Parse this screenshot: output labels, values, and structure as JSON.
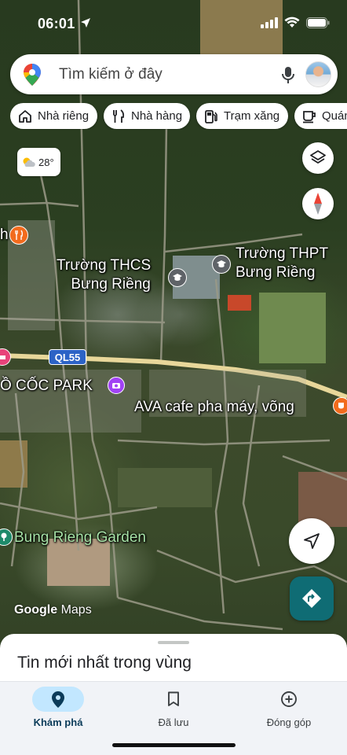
{
  "status_bar": {
    "time": "06:01"
  },
  "search": {
    "placeholder": "Tìm kiếm ở đây"
  },
  "chips": [
    {
      "label": "Nhà riêng",
      "icon": "home-icon"
    },
    {
      "label": "Nhà hàng",
      "icon": "restaurant-icon"
    },
    {
      "label": "Trạm xăng",
      "icon": "gas-station-icon"
    },
    {
      "label": "Quán",
      "icon": "coffee-icon"
    }
  ],
  "weather": {
    "temperature": "28°",
    "icon": "partly-cloudy-icon"
  },
  "map_labels": {
    "school_thcs_line1": "Trường THCS",
    "school_thcs_line2": "Bưng Riềng",
    "school_thpt_line1": "Trường THPT",
    "school_thpt_line2": "Bưng Riềng",
    "road_shield": "QL55",
    "park": "Ồ CỐC PARK",
    "cafe": "AVA cafe pha máy, võng",
    "garden": "Bung Rieng Garden"
  },
  "attribution": {
    "brand": "Google",
    "product": "Maps"
  },
  "sheet": {
    "title": "Tin mới nhất trong vùng"
  },
  "nav": {
    "explore": "Khám phá",
    "saved": "Đã lưu",
    "contribute": "Đóng góp"
  },
  "colors": {
    "accent_teal": "#0f6c74",
    "nav_active": "#c2e7ff",
    "road_yellow": "#e8d79a",
    "poi_orange": "#f26b1d",
    "poi_purple": "#a142f4",
    "poi_teal": "#1e8a8a"
  }
}
